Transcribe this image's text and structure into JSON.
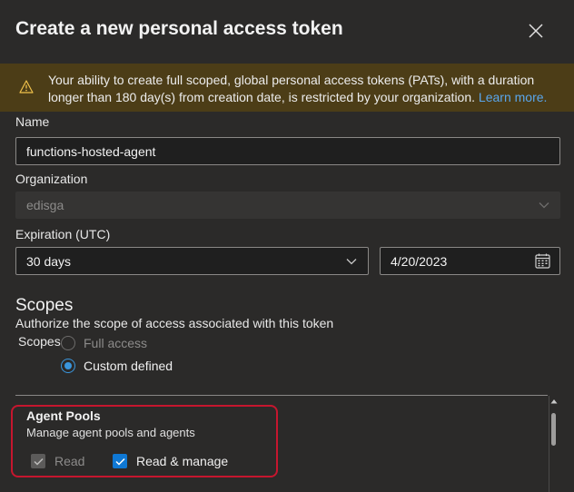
{
  "dialog": {
    "title": "Create a new personal access token"
  },
  "warning": {
    "text": "Your ability to create full scoped, global personal access tokens (PATs), with a duration longer than 180 day(s) from creation date, is restricted by your organization.",
    "link": "Learn more."
  },
  "name": {
    "label": "Name",
    "value": "functions-hosted-agent"
  },
  "organization": {
    "label": "Organization",
    "value": "edisga"
  },
  "expiration": {
    "label": "Expiration (UTC)",
    "duration": "30 days",
    "date": "4/20/2023"
  },
  "scopes": {
    "heading": "Scopes",
    "description": "Authorize the scope of access associated with this token",
    "label": "Scopes",
    "options": [
      "Full access",
      "Custom defined"
    ],
    "selected": "Custom defined"
  },
  "agent_pools": {
    "title": "Agent Pools",
    "description": "Manage agent pools and agents",
    "read_label": "Read",
    "read_manage_label": "Read & manage"
  },
  "colors": {
    "background": "#2b2a29",
    "warning_bg": "#4c3d17",
    "accent": "#0f78d4",
    "highlight": "#c6162e"
  },
  "icons": {
    "close": "close-icon",
    "warning": "warning-icon",
    "chevron": "chevron-down-icon",
    "calendar": "calendar-icon"
  }
}
